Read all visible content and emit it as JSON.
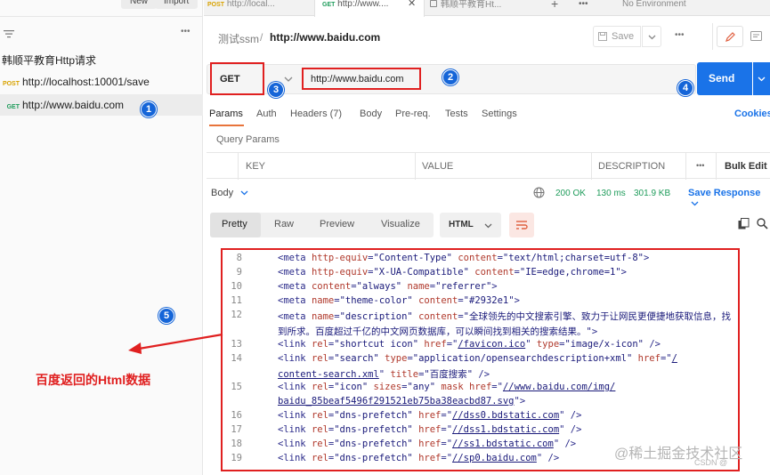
{
  "sidebar": {
    "new_label": "New",
    "import_label": "Import",
    "more_label": "•••",
    "collection_name": "韩顺平教育Http请求",
    "requests": [
      {
        "method": "POST",
        "url": "http://localhost:10001/save"
      },
      {
        "method": "GET",
        "url": "http://www.baidu.com"
      }
    ]
  },
  "tabs": [
    {
      "method": "POST",
      "label": "http://local..."
    },
    {
      "method": "GET",
      "label": "http://www...."
    },
    {
      "method": "",
      "label": "韩顺平教育Ht..."
    }
  ],
  "tabbar": {
    "close": "✕",
    "add": "+",
    "more": "•••",
    "environment": "No Environment"
  },
  "breadcrumb": {
    "collection": "测试ssm",
    "separator": "/",
    "request": "http://www.baidu.com"
  },
  "toolbar": {
    "save_label": "Save",
    "more": "•••"
  },
  "request": {
    "method": "GET",
    "url": "http://www.baidu.com",
    "send_label": "Send"
  },
  "request_tabs": {
    "params": "Params",
    "auth": "Auth",
    "headers": "Headers (7)",
    "body": "Body",
    "prereq": "Pre-req.",
    "tests": "Tests",
    "settings": "Settings",
    "cookies": "Cookies"
  },
  "query_params": {
    "title": "Query Params",
    "key": "KEY",
    "value": "VALUE",
    "description": "DESCRIPTION",
    "more": "•••",
    "bulk_edit": "Bulk Edit"
  },
  "response": {
    "body_label": "Body",
    "status": "200 OK",
    "time": "130 ms",
    "size": "301.9 KB",
    "save_response": "Save Response",
    "views": [
      "Pretty",
      "Raw",
      "Preview",
      "Visualize"
    ],
    "format": "HTML"
  },
  "code_lines": [
    {
      "n": "8",
      "parts": [
        [
          "t",
          "<meta "
        ],
        [
          "a",
          "http-equiv"
        ],
        [
          "t",
          "="
        ],
        [
          "v",
          "\"Content-Type\""
        ],
        [
          "t",
          " "
        ],
        [
          "a",
          "content"
        ],
        [
          "t",
          "="
        ],
        [
          "v",
          "\"text/html;charset=utf-8\""
        ],
        [
          "t",
          ">"
        ]
      ]
    },
    {
      "n": "9",
      "parts": [
        [
          "t",
          "<meta "
        ],
        [
          "a",
          "http-equiv"
        ],
        [
          "t",
          "="
        ],
        [
          "v",
          "\"X-UA-Compatible\""
        ],
        [
          "t",
          " "
        ],
        [
          "a",
          "content"
        ],
        [
          "t",
          "="
        ],
        [
          "v",
          "\"IE=edge,chrome=1\""
        ],
        [
          "t",
          ">"
        ]
      ]
    },
    {
      "n": "10",
      "parts": [
        [
          "t",
          "<meta "
        ],
        [
          "a",
          "content"
        ],
        [
          "t",
          "="
        ],
        [
          "v",
          "\"always\""
        ],
        [
          "t",
          " "
        ],
        [
          "a",
          "name"
        ],
        [
          "t",
          "="
        ],
        [
          "v",
          "\"referrer\""
        ],
        [
          "t",
          ">"
        ]
      ]
    },
    {
      "n": "11",
      "parts": [
        [
          "t",
          "<meta "
        ],
        [
          "a",
          "name"
        ],
        [
          "t",
          "="
        ],
        [
          "v",
          "\"theme-color\""
        ],
        [
          "t",
          " "
        ],
        [
          "a",
          "content"
        ],
        [
          "t",
          "="
        ],
        [
          "v",
          "\"#2932e1\""
        ],
        [
          "t",
          ">"
        ]
      ]
    },
    {
      "n": "12",
      "parts": [
        [
          "t",
          "<meta "
        ],
        [
          "a",
          "name"
        ],
        [
          "t",
          "="
        ],
        [
          "v",
          "\"description\""
        ],
        [
          "t",
          " "
        ],
        [
          "a",
          "content"
        ],
        [
          "t",
          "="
        ],
        [
          "v",
          "\"全球领先的中文搜索引擎、致力于让网民更便捷地获取信息，找"
        ]
      ]
    },
    {
      "n": "",
      "parts": [
        [
          "v",
          "  到所求。百度超过千亿的中文网页数据库，可以瞬间找到相关的搜索结果。\""
        ],
        [
          "t",
          ">"
        ]
      ]
    },
    {
      "n": "13",
      "parts": [
        [
          "t",
          "<link "
        ],
        [
          "a",
          "rel"
        ],
        [
          "t",
          "="
        ],
        [
          "v",
          "\"shortcut icon\""
        ],
        [
          "t",
          " "
        ],
        [
          "a",
          "href"
        ],
        [
          "t",
          "=\""
        ],
        [
          "l",
          "/favicon.ico"
        ],
        [
          "t",
          "\" "
        ],
        [
          "a",
          "type"
        ],
        [
          "t",
          "="
        ],
        [
          "v",
          "\"image/x-icon\""
        ],
        [
          "t",
          " />"
        ]
      ]
    },
    {
      "n": "14",
      "parts": [
        [
          "t",
          "<link "
        ],
        [
          "a",
          "rel"
        ],
        [
          "t",
          "="
        ],
        [
          "v",
          "\"search\""
        ],
        [
          "t",
          " "
        ],
        [
          "a",
          "type"
        ],
        [
          "t",
          "="
        ],
        [
          "v",
          "\"application/opensearchdescription+xml\""
        ],
        [
          "t",
          " "
        ],
        [
          "a",
          "href"
        ],
        [
          "t",
          "=\""
        ],
        [
          "l",
          "/"
        ]
      ]
    },
    {
      "n": "",
      "parts": [
        [
          "l",
          "  content-search.xml"
        ],
        [
          "t",
          "\" "
        ],
        [
          "a",
          "title"
        ],
        [
          "t",
          "="
        ],
        [
          "v",
          "\"百度搜索\""
        ],
        [
          "t",
          " />"
        ]
      ]
    },
    {
      "n": "15",
      "parts": [
        [
          "t",
          "<link "
        ],
        [
          "a",
          "rel"
        ],
        [
          "t",
          "="
        ],
        [
          "v",
          "\"icon\""
        ],
        [
          "t",
          " "
        ],
        [
          "a",
          "sizes"
        ],
        [
          "t",
          "="
        ],
        [
          "v",
          "\"any\""
        ],
        [
          "t",
          " "
        ],
        [
          "a",
          "mask"
        ],
        [
          "t",
          " "
        ],
        [
          "a",
          "href"
        ],
        [
          "t",
          "=\""
        ],
        [
          "l",
          "//www.baidu.com/img/"
        ]
      ]
    },
    {
      "n": "",
      "parts": [
        [
          "l",
          "  baidu_85beaf5496f291521eb75ba38eacbd87.svg"
        ],
        [
          "t",
          "\">"
        ]
      ]
    },
    {
      "n": "16",
      "parts": [
        [
          "t",
          "<link "
        ],
        [
          "a",
          "rel"
        ],
        [
          "t",
          "="
        ],
        [
          "v",
          "\"dns-prefetch\""
        ],
        [
          "t",
          " "
        ],
        [
          "a",
          "href"
        ],
        [
          "t",
          "=\""
        ],
        [
          "l",
          "//dss0.bdstatic.com"
        ],
        [
          "t",
          "\" />"
        ]
      ]
    },
    {
      "n": "17",
      "parts": [
        [
          "t",
          "<link "
        ],
        [
          "a",
          "rel"
        ],
        [
          "t",
          "="
        ],
        [
          "v",
          "\"dns-prefetch\""
        ],
        [
          "t",
          " "
        ],
        [
          "a",
          "href"
        ],
        [
          "t",
          "=\""
        ],
        [
          "l",
          "//dss1.bdstatic.com"
        ],
        [
          "t",
          "\" />"
        ]
      ]
    },
    {
      "n": "18",
      "parts": [
        [
          "t",
          "<link "
        ],
        [
          "a",
          "rel"
        ],
        [
          "t",
          "="
        ],
        [
          "v",
          "\"dns-prefetch\""
        ],
        [
          "t",
          " "
        ],
        [
          "a",
          "href"
        ],
        [
          "t",
          "=\""
        ],
        [
          "l",
          "//ss1.bdstatic.com"
        ],
        [
          "t",
          "\" />"
        ]
      ]
    },
    {
      "n": "19",
      "parts": [
        [
          "t",
          "<link "
        ],
        [
          "a",
          "rel"
        ],
        [
          "t",
          "="
        ],
        [
          "v",
          "\"dns-prefetch\""
        ],
        [
          "t",
          " "
        ],
        [
          "a",
          "href"
        ],
        [
          "t",
          "=\""
        ],
        [
          "l",
          "//sp0.baidu.com"
        ],
        [
          "t",
          "\" />"
        ]
      ]
    }
  ],
  "annotations": {
    "n1": "1",
    "n2": "2",
    "n3": "3",
    "n4": "4",
    "n5": "5",
    "caption": "百度返回的Html数据"
  },
  "watermark": {
    "main": "@稀土掘金技术社区",
    "sub": "CSDN @"
  },
  "colors": {
    "accent": "#1a73e8",
    "annotation_red": "#e02020",
    "annotation_circle": "#1565d8",
    "get": "#1f9c5b",
    "post": "#d8a200"
  }
}
